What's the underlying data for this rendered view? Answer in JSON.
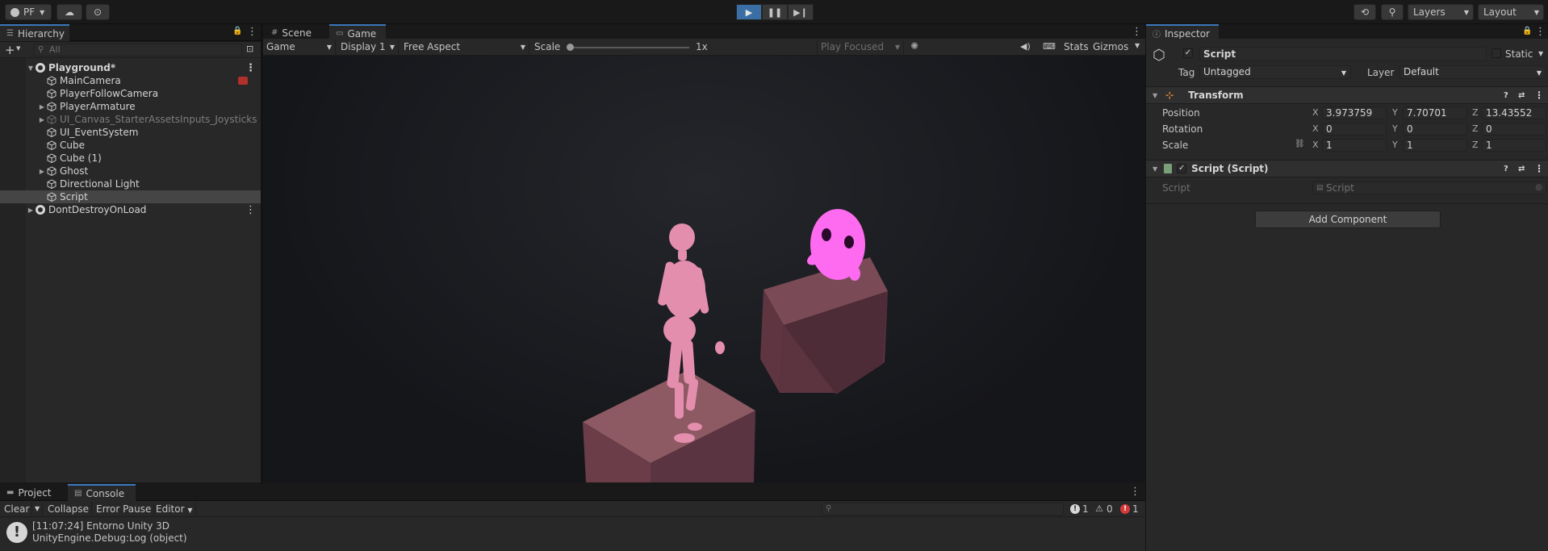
{
  "toolbar": {
    "account": "PF",
    "play_icon": "play-icon",
    "pause_icon": "pause-icon",
    "step_icon": "step-icon",
    "layers_label": "Layers",
    "layout_label": "Layout"
  },
  "hierarchy": {
    "tab_label": "Hierarchy",
    "search_placeholder": "All",
    "items": [
      {
        "label": "Playground*",
        "indent": 0,
        "expanded": true,
        "type": "scene"
      },
      {
        "label": "MainCamera",
        "indent": 1,
        "type": "go"
      },
      {
        "label": "PlayerFollowCamera",
        "indent": 1,
        "type": "go"
      },
      {
        "label": "PlayerArmature",
        "indent": 1,
        "type": "go",
        "collapsed": true
      },
      {
        "label": "UI_Canvas_StarterAssetsInputs_Joysticks",
        "indent": 1,
        "type": "go",
        "collapsed": true,
        "dim": true
      },
      {
        "label": "UI_EventSystem",
        "indent": 1,
        "type": "go"
      },
      {
        "label": "Cube",
        "indent": 1,
        "type": "go"
      },
      {
        "label": "Cube (1)",
        "indent": 1,
        "type": "go"
      },
      {
        "label": "Ghost",
        "indent": 1,
        "type": "go",
        "collapsed": true
      },
      {
        "label": "Directional Light",
        "indent": 1,
        "type": "go"
      },
      {
        "label": "Script",
        "indent": 1,
        "type": "go",
        "selected": true
      },
      {
        "label": "DontDestroyOnLoad",
        "indent": 0,
        "type": "scene",
        "collapsed": true
      }
    ]
  },
  "view_tabs": {
    "scene": "Scene",
    "game": "Game"
  },
  "game_toolbar": {
    "mode": "Game",
    "display": "Display 1",
    "aspect": "Free Aspect",
    "scale_label": "Scale",
    "scale_value": "1x",
    "play_focused": "Play Focused",
    "stats": "Stats",
    "gizmos": "Gizmos"
  },
  "inspector": {
    "tab_label": "Inspector",
    "object_name": "Script",
    "static_label": "Static",
    "tag_label": "Tag",
    "tag_value": "Untagged",
    "layer_label": "Layer",
    "layer_value": "Default",
    "transform": {
      "title": "Transform",
      "position_label": "Position",
      "rotation_label": "Rotation",
      "scale_label": "Scale",
      "position": {
        "x": "3.973759",
        "y": "7.70701",
        "z": "13.43552"
      },
      "rotation": {
        "x": "0",
        "y": "0",
        "z": "0"
      },
      "scale": {
        "x": "1",
        "y": "1",
        "z": "1"
      },
      "axis_x": "X",
      "axis_y": "Y",
      "axis_z": "Z"
    },
    "script_component": {
      "title": "Script (Script)",
      "field_label": "Script",
      "field_value": "Script"
    },
    "add_component": "Add Component"
  },
  "console": {
    "project_tab": "Project",
    "console_tab": "Console",
    "clear": "Clear",
    "collapse": "Collapse",
    "error_pause": "Error Pause",
    "editor": "Editor",
    "info_count": "1",
    "warn_count": "0",
    "error_count": "1",
    "log_line1": "[11:07:24] Entorno Unity 3D",
    "log_line2": "UnityEngine.Debug:Log (object)"
  },
  "colors": {
    "accent": "#3a79bb",
    "play_active": "#3a6fa5",
    "ghost": "#ff6bf0",
    "figure": "#e98db0",
    "cube": "#6e3e49"
  }
}
